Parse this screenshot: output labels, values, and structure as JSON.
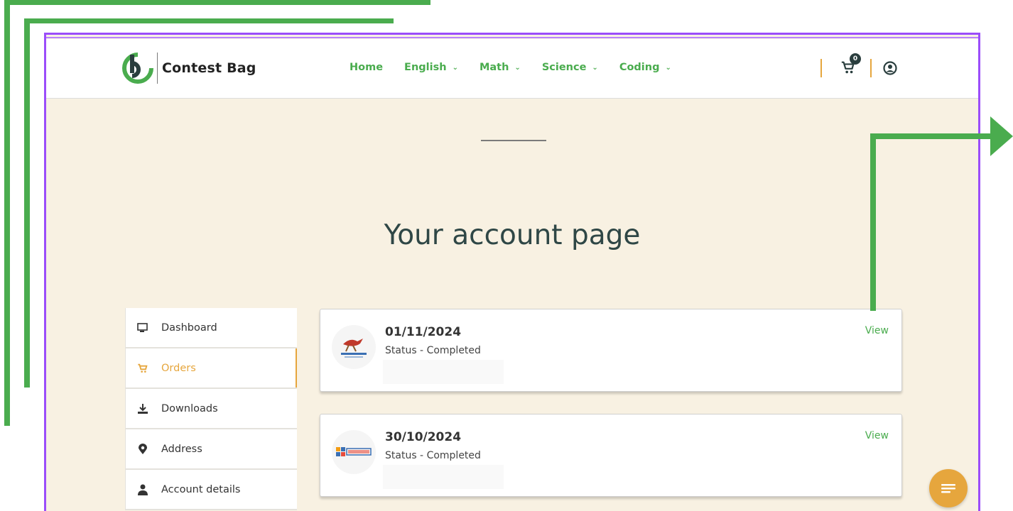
{
  "colors": {
    "brand_green": "#4aac4e",
    "accent_orange": "#e6a63d",
    "frame_purple": "#9b4dfa",
    "page_bg": "#f8f1e2",
    "title_color": "#2f4746"
  },
  "header": {
    "brand": "Contest Bag",
    "nav": [
      {
        "label": "Home",
        "dropdown": false
      },
      {
        "label": "English",
        "dropdown": true
      },
      {
        "label": "Math",
        "dropdown": true
      },
      {
        "label": "Science",
        "dropdown": true
      },
      {
        "label": "Coding",
        "dropdown": true
      }
    ],
    "cart_count": "0",
    "icons": {
      "cart": "cart-icon",
      "user": "user-circle-icon",
      "chevron": "chevron-down-icon"
    }
  },
  "main": {
    "title": "Your account page"
  },
  "sidebar": {
    "items": [
      {
        "label": "Dashboard",
        "icon": "dashboard-icon",
        "active": false
      },
      {
        "label": "Orders",
        "icon": "cart-icon",
        "active": true
      },
      {
        "label": "Downloads",
        "icon": "download-icon",
        "active": false
      },
      {
        "label": "Address",
        "icon": "map-pin-icon",
        "active": false
      },
      {
        "label": "Account details",
        "icon": "user-icon",
        "active": false
      }
    ]
  },
  "orders": [
    {
      "date": "01/11/2024",
      "status": "Status - Completed",
      "action": "View",
      "logo_icon": "kangaroo-logo-icon"
    },
    {
      "date": "30/10/2024",
      "status": "Status - Completed",
      "action": "View",
      "logo_icon": "cemc-logo-icon"
    }
  ],
  "fab": {
    "icon": "menu-lines-icon"
  }
}
